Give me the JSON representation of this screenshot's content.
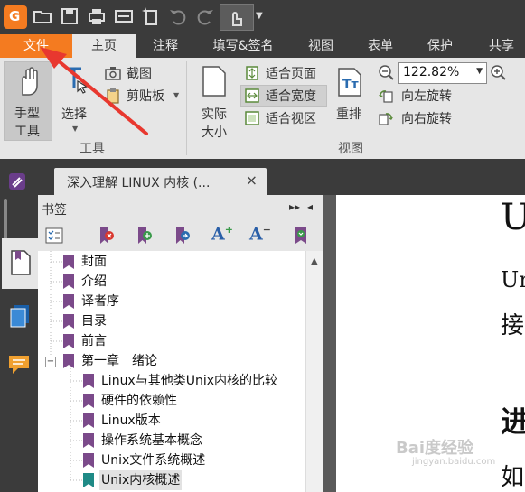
{
  "title_bar": {
    "icons": [
      "app-logo-icon",
      "open-folder-icon",
      "save-icon",
      "print-icon",
      "properties-icon",
      "new-icon",
      "undo-icon",
      "redo-icon",
      "hand-touch-icon",
      "customize-dropdown-icon"
    ]
  },
  "tabs": {
    "file": "文件",
    "home": "主页",
    "annotate": "注释",
    "fill_sign": "填写&签名",
    "view": "视图",
    "form": "表单",
    "protect": "保护",
    "share": "共享"
  },
  "ribbon": {
    "tools": {
      "hand_line1": "手型",
      "hand_line2": "工具",
      "select": "选择",
      "screenshot": "截图",
      "clipboard": "剪贴板",
      "group_label": "工具"
    },
    "view": {
      "actual_line1": "实际",
      "actual_line2": "大小",
      "fit_page": "适合页面",
      "fit_width": "适合宽度",
      "fit_visible": "适合视区",
      "reflow": "重排",
      "zoom_value": "122.82%",
      "rotate_left": "向左旋转",
      "rotate_right": "向右旋转",
      "group_label": "视图"
    }
  },
  "document_tab": {
    "title": "深入理解 LINUX 内核 (...",
    "close": "×"
  },
  "bookmarks": {
    "title": "书签",
    "items": [
      {
        "label": "封面",
        "level": 0
      },
      {
        "label": "介绍",
        "level": 0
      },
      {
        "label": "译者序",
        "level": 0
      },
      {
        "label": "目录",
        "level": 0
      },
      {
        "label": "前言",
        "level": 0
      },
      {
        "label": "第一章　绪论",
        "level": 0,
        "expanded": true
      },
      {
        "label": "Linux与其他类Unix内核的比较",
        "level": 1
      },
      {
        "label": "硬件的依赖性",
        "level": 1
      },
      {
        "label": "Linux版本",
        "level": 1
      },
      {
        "label": "操作系统基本概念",
        "level": 1
      },
      {
        "label": "Unix文件系统概述",
        "level": 1
      },
      {
        "label": "Unix内核概述",
        "level": 1,
        "selected": true
      }
    ],
    "collapse_marker": "−"
  },
  "page_text": {
    "line1": "U",
    "line2": "Un",
    "line3": "接",
    "line4": "进",
    "line5": "如"
  },
  "watermark": {
    "text": "Bai度经验",
    "sub": "jingyan.baidu.com"
  },
  "colors": {
    "accent": "#f47b20",
    "dark_chrome": "#3b3b3b",
    "ribbon_bg": "#e6e6e6",
    "bookmark_purple": "#7b4a8a",
    "bookmark_teal": "#1f8a86",
    "arrow_red": "#e8382f"
  }
}
